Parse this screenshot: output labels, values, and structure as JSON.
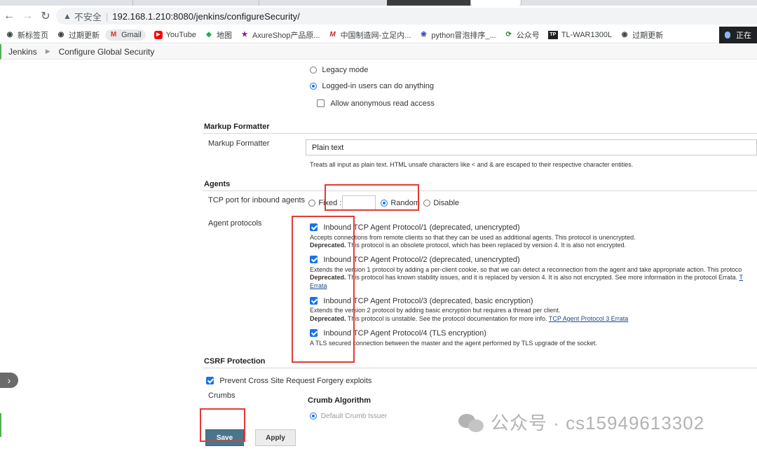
{
  "browser": {
    "url_warning": "不安全",
    "url": "192.168.1.210:8080/jenkins/configureSecurity/",
    "bookmarks": [
      {
        "icon": "globe-icon",
        "label": "新标签页"
      },
      {
        "icon": "globe-icon",
        "label": "过期更新"
      },
      {
        "icon": "gmail-icon",
        "label": "Gmail"
      },
      {
        "icon": "youtube-icon",
        "label": "YouTube"
      },
      {
        "icon": "maps-icon",
        "label": "地图"
      },
      {
        "icon": "star-icon",
        "label": "AxureShop产品原..."
      },
      {
        "icon": "m-logo-icon",
        "label": "中国制造网-立足内..."
      },
      {
        "icon": "python-icon",
        "label": "python冒泡排序_..."
      },
      {
        "icon": "refresh-icon",
        "label": "公众号"
      },
      {
        "icon": "tp-icon",
        "label": "TL-WAR1300L"
      },
      {
        "icon": "globe-icon",
        "label": "过期更新"
      }
    ],
    "voice_label": "正在"
  },
  "breadcrumb": {
    "root": "Jenkins",
    "current": "Configure Global Security"
  },
  "authorization": {
    "legacy_mode": "Legacy mode",
    "logged_in": "Logged-in users can do anything",
    "anonymous_read": "Allow anonymous read access"
  },
  "markup_formatter": {
    "section_title": "Markup Formatter",
    "field_label": "Markup Formatter",
    "value": "Plain text",
    "help": "Treats all input as plain text. HTML unsafe characters like < and & are escaped to their respective character entities."
  },
  "agents": {
    "section_title": "Agents",
    "tcp_label": "TCP port for inbound agents",
    "fixed_label": "Fixed :",
    "random_label": "Random",
    "disable_label": "Disable",
    "protocols_label": "Agent protocols",
    "protocols": [
      {
        "name": "Inbound TCP Agent Protocol/1 (deprecated, unencrypted)",
        "desc": "Accepts connections from remote clients so that they can be used as additional agents. This protocol is unencrypted.",
        "deprecated_label": "Deprecated.",
        "deprecated_text": " This protocol is an obsolete protocol, which has been replaced by version 4. It is also not encrypted."
      },
      {
        "name": "Inbound TCP Agent Protocol/2 (deprecated, unencrypted)",
        "desc": "Extends the version 1 protocol by adding a per-client cookie, so that we can detect a reconnection from the agent and take appropriate action. This protoco",
        "deprecated_label": "Deprecated.",
        "deprecated_text": " This protocol has known stability issues, and it is replaced by version 4. It is also not encrypted. See more information in the protocol Errata. ",
        "link_tail": "T",
        "link2": "Errata"
      },
      {
        "name": "Inbound TCP Agent Protocol/3 (deprecated, basic encryption)",
        "desc": "Extends the version 2 protocol by adding basic encryption but requires a thread per client.",
        "deprecated_label": "Deprecated.",
        "deprecated_text": " This protocol is unstable. See the protocol documentation for more info. ",
        "link": "TCP Agent Protocol 3 Errata"
      },
      {
        "name": "Inbound TCP Agent Protocol/4 (TLS encryption)",
        "desc": "A TLS secured connection between the master and the agent performed by TLS upgrade of the socket."
      }
    ]
  },
  "csrf": {
    "section_title": "CSRF Protection",
    "prevent_label": "Prevent Cross Site Request Forgery exploits",
    "crumbs_label": "Crumbs",
    "algorithm_title": "Crumb Algorithm",
    "default_issuer": "Default Crumb Issuer"
  },
  "buttons": {
    "save": "Save",
    "apply": "Apply"
  },
  "watermark": {
    "text": "公众号 · cs15949613302"
  },
  "colors": {
    "annotation_red": "#e53935",
    "jenkins_blue": "#4b758b",
    "checkbox_blue": "#1a73e8"
  }
}
